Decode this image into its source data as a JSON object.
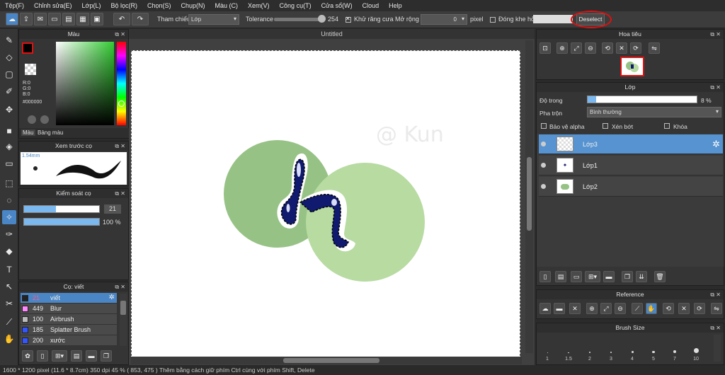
{
  "menu": [
    "Tệp(F)",
    "Chỉnh sửa(E)",
    "Lớp(L)",
    "Bộ lọc(R)",
    "Chọn(S)",
    "Chụp(N)",
    "Màu (C)",
    "Xem(V)",
    "Công cụ(T)",
    "Cửa sổ(W)",
    "Cloud",
    "Help"
  ],
  "toolbar": {
    "tham_chieu_label": "Tham chiếu",
    "tham_chieu_value": "Lớp",
    "tolerance_label": "Tolerance",
    "tolerance_value": "254",
    "khu_rang_cua": "Khử răng cưa",
    "mo_rong_label": "Mở rộng",
    "mo_rong_value": "0",
    "pixel_label": "pixel",
    "dong_khe_ho": "Đóng khe hở",
    "deselect": "Deselect"
  },
  "color_panel": {
    "title": "Màu",
    "r": "R:0",
    "g": "G:0",
    "b": "B:0",
    "hex": "#000000",
    "tab_mau": "Màu",
    "tab_bang_mau": "Bảng màu"
  },
  "brush_preview": {
    "title": "Xem trước cọ",
    "size": "1.54mm"
  },
  "brush_control": {
    "title": "Kiểm soát cọ",
    "size_value": "21",
    "opacity_value": "100 %",
    "size_fraction": 0.42,
    "opacity_fraction": 1.0
  },
  "brush_list": {
    "title": "Cọ: viết",
    "items": [
      {
        "num": "21",
        "name": "viết",
        "color": "#222222"
      },
      {
        "num": "449",
        "name": "Blur",
        "color": "#ff88ff"
      },
      {
        "num": "100",
        "name": "Airbrush",
        "color": "#bbbbbb"
      },
      {
        "num": "185",
        "name": "Splatter Brush",
        "color": "#3355ff"
      },
      {
        "num": "200",
        "name": "xước",
        "color": "#3355ff"
      }
    ]
  },
  "document": {
    "tab": "Untitled",
    "watermark": "@ Kun"
  },
  "navigator": {
    "title": "Hoa tiêu"
  },
  "layers": {
    "title": "Lớp",
    "opacity_label": "Độ trong",
    "opacity_value": "8 %",
    "opacity_fraction": 0.08,
    "blend_label": "Pha trộn",
    "blend_value": "Bình thường",
    "protect_alpha": "Bảo vệ alpha",
    "clipping": "Xén bớt",
    "lock": "Khóa",
    "items": [
      {
        "name": "Lớp3",
        "selected": true
      },
      {
        "name": "Lớp1",
        "selected": false
      },
      {
        "name": "Lớp2",
        "selected": false
      }
    ]
  },
  "reference": {
    "title": "Reference"
  },
  "brush_size": {
    "title": "Brush Size",
    "labels": [
      "1",
      "1.5",
      "2",
      "3",
      "4",
      "5",
      "7",
      "10"
    ]
  },
  "status": {
    "dims": "1600 * 1200 pixel",
    "physical": "(11.6 * 8.7cm)",
    "dpi": "350 dpi",
    "zoom": "45 %",
    "coords": "( 853, 475 )",
    "hint": "Thêm bằng cách giữ phím Ctrl cùng với phím Shift, Delete"
  },
  "colors": {
    "accent": "#4a86c5",
    "circle_dark": "#97c285",
    "circle_light": "#b7dba1",
    "letter": "#101a6e",
    "highlight_circle": "#e01010"
  }
}
